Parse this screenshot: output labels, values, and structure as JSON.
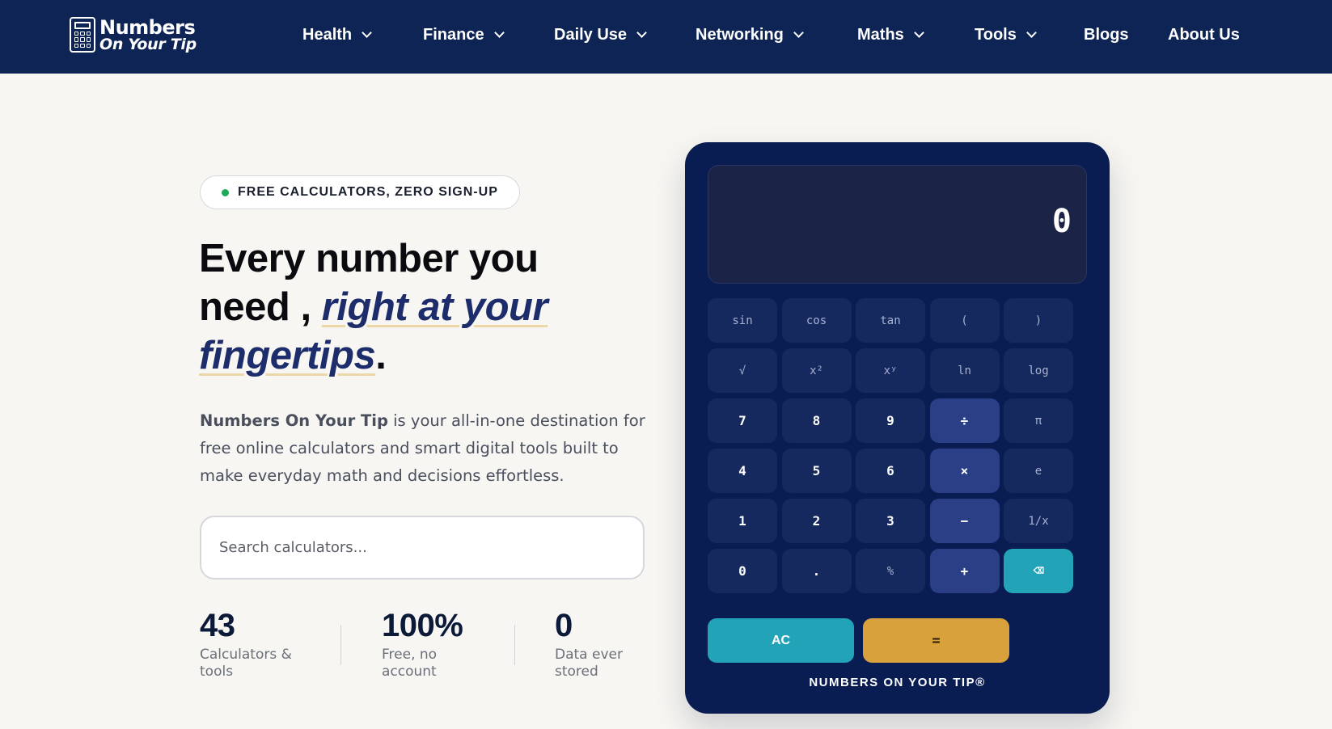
{
  "brand": {
    "line1": "Numbers",
    "line2": "On Your Tip"
  },
  "nav": [
    {
      "label": "Health",
      "dropdown": true
    },
    {
      "label": "Finance",
      "dropdown": true
    },
    {
      "label": "Daily Use",
      "dropdown": true
    },
    {
      "label": "Networking",
      "dropdown": true
    },
    {
      "label": "Maths",
      "dropdown": true
    },
    {
      "label": "Tools",
      "dropdown": true
    },
    {
      "label": "Blogs",
      "dropdown": false
    },
    {
      "label": "About Us",
      "dropdown": false
    }
  ],
  "hero": {
    "badge": "FREE CALCULATORS, ZERO SIGN-UP",
    "headline_plain": "Every number you need , ",
    "headline_highlight_1": "right at your",
    "headline_highlight_2": "fingertips",
    "headline_end": ".",
    "desc_bold": "Numbers On Your Tip",
    "desc_rest": " is your all-in-one destination for free online calculators and smart digital tools built to make everyday math and decisions effortless.",
    "search_placeholder": "Search calculators...",
    "stats": [
      {
        "value": "43",
        "label": "Calculators & tools"
      },
      {
        "value": "100%",
        "label": "Free, no account"
      },
      {
        "value": "0",
        "label": "Data ever stored"
      }
    ]
  },
  "calculator": {
    "display": "0",
    "rows": [
      [
        "sin",
        "cos",
        "tan",
        "(",
        ")"
      ],
      [
        "√",
        "x²",
        "xʸ",
        "ln",
        "log"
      ],
      [
        "7",
        "8",
        "9",
        "÷",
        "π"
      ],
      [
        "4",
        "5",
        "6",
        "×",
        "e"
      ],
      [
        "1",
        "2",
        "3",
        "−",
        "1/x"
      ],
      [
        "0",
        ".",
        "%",
        "+",
        "⌫"
      ]
    ],
    "clear_label": "AC",
    "equals_label": "=",
    "brand": "NUMBERS ON YOUR TIP®"
  },
  "colors": {
    "header_bg": "#0d2454",
    "accent_teal": "#22a3b8",
    "accent_gold": "#d9a13b",
    "calc_bg": "#0a1d52"
  }
}
